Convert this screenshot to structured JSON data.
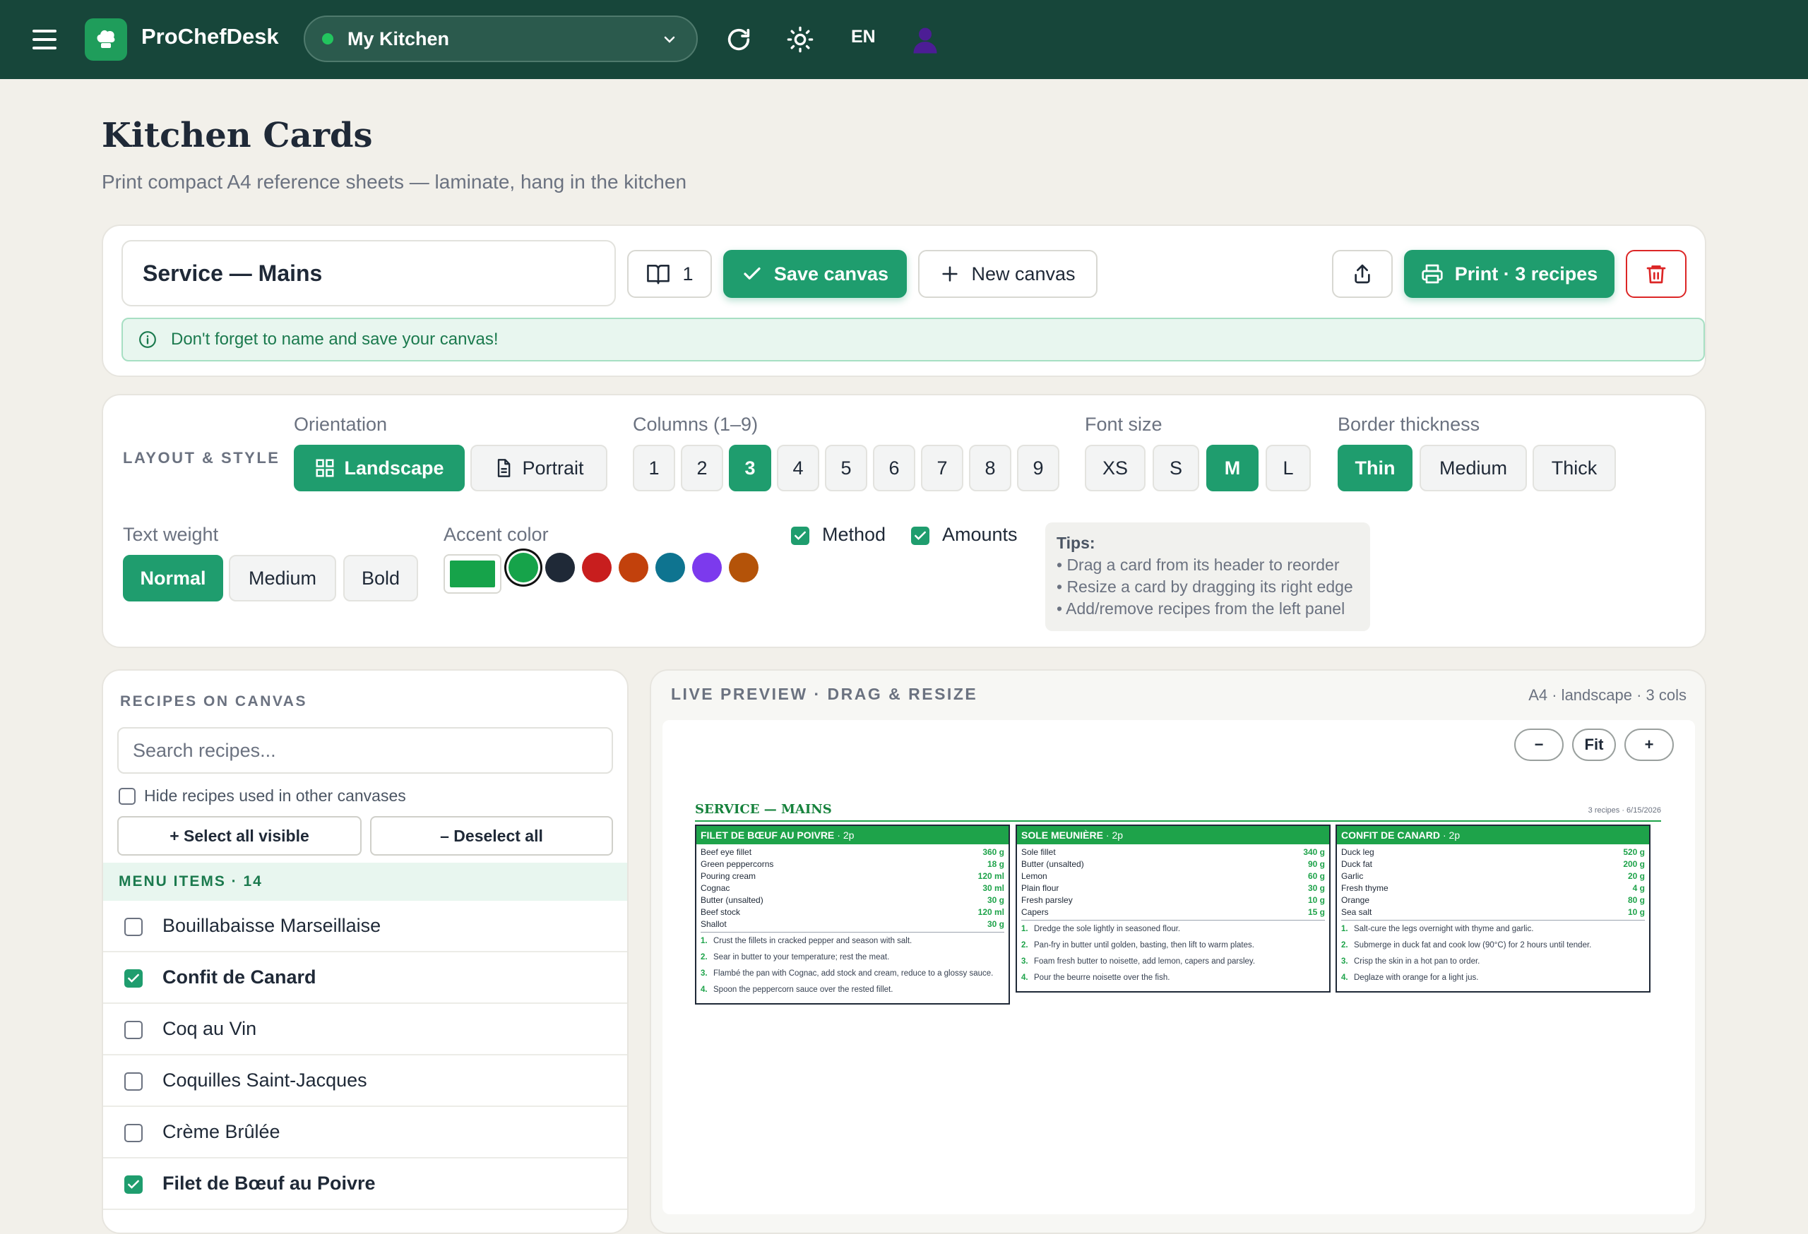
{
  "topbar": {
    "brand": "ProChefDesk",
    "kitchen": "My Kitchen",
    "lang": "EN",
    "icons": [
      "menu-icon",
      "chef-hat-icon",
      "refresh-icon",
      "sun-icon",
      "user-icon"
    ],
    "accent": "#17463a"
  },
  "page": {
    "title": "Kitchen Cards",
    "subtitle": "Print compact A4 reference sheets — laminate, hang in the kitchen"
  },
  "canvas_bar": {
    "name": "Service — Mains",
    "count": "1",
    "save_label": "Save canvas",
    "new_label": "New canvas",
    "print_label": "Print · 3 recipes",
    "notice": "Don't forget to name and save your canvas!"
  },
  "layout": {
    "section_label": "LAYOUT & STYLE",
    "orientation_label": "Orientation",
    "orientation": [
      "Landscape",
      "Portrait"
    ],
    "columns_label": "Columns (1–9)",
    "columns": [
      "1",
      "2",
      "3",
      "4",
      "5",
      "6",
      "7",
      "8",
      "9"
    ],
    "font_size_label": "Font size",
    "font_sizes": [
      "XS",
      "S",
      "M",
      "L"
    ],
    "border_label": "Border thickness",
    "borders": [
      "Thin",
      "Medium",
      "Thick"
    ],
    "weight_label": "Text weight",
    "weights": [
      "Normal",
      "Medium",
      "Bold"
    ],
    "accent_label": "Accent color",
    "accent_current": "#16a34a",
    "swatches": [
      "#16a34a",
      "#1f2937",
      "#c81e1e",
      "#c2410c",
      "#0e7490",
      "#7c3aed",
      "#b45309"
    ],
    "method_label": "Method",
    "amounts_label": "Amounts",
    "tips_title": "Tips:",
    "tips": [
      "• Drag a card from its header to reorder",
      "• Resize a card by dragging its right edge",
      "• Add/remove recipes from the left panel"
    ],
    "selected": {
      "orientation": "Landscape",
      "columns": "3",
      "font_size": "M",
      "border": "Thin",
      "weight": "Normal"
    }
  },
  "recipes_panel": {
    "title": "RECIPES ON CANVAS",
    "search_placeholder": "Search recipes...",
    "hide_label": "Hide recipes used in other canvases",
    "select_all": "+ Select all visible",
    "deselect_all": "– Deselect all",
    "group_label": "MENU ITEMS · 14",
    "items": [
      {
        "name": "Bouillabaisse Marseillaise",
        "checked": false
      },
      {
        "name": "Confit de Canard",
        "checked": true
      },
      {
        "name": "Coq au Vin",
        "checked": false
      },
      {
        "name": "Coquilles Saint-Jacques",
        "checked": false
      },
      {
        "name": "Crème Brûlée",
        "checked": false
      },
      {
        "name": "Filet de Bœuf au Poivre",
        "checked": true
      }
    ]
  },
  "preview": {
    "title": "LIVE PREVIEW · DRAG & RESIZE",
    "meta": "A4 · landscape · 3 cols",
    "zoom_out": "−",
    "fit": "Fit",
    "zoom_in": "+",
    "sheet_title": "SERVICE — MAINS",
    "sheet_meta": "3 recipes · 6/15/2026",
    "cards": [
      {
        "name": "FILET DE BŒUF AU POIVRE",
        "portions": "· 2p",
        "ingredients": [
          [
            "Beef eye fillet",
            "360 g"
          ],
          [
            "Green peppercorns",
            "18 g"
          ],
          [
            "Pouring cream",
            "120 ml"
          ],
          [
            "Cognac",
            "30 ml"
          ],
          [
            "Butter (unsalted)",
            "30 g"
          ],
          [
            "Beef stock",
            "120 ml"
          ],
          [
            "Shallot",
            "30 g"
          ]
        ],
        "steps": [
          "Crust the fillets in cracked pepper and season with salt.",
          "Sear in butter to your temperature; rest the meat.",
          "Flambé the pan with Cognac, add stock and cream, reduce to a glossy sauce.",
          "Spoon the peppercorn sauce over the rested fillet."
        ]
      },
      {
        "name": "SOLE MEUNIÈRE",
        "portions": "· 2p",
        "ingredients": [
          [
            "Sole fillet",
            "340 g"
          ],
          [
            "Butter (unsalted)",
            "90 g"
          ],
          [
            "Lemon",
            "60 g"
          ],
          [
            "Plain flour",
            "30 g"
          ],
          [
            "Fresh parsley",
            "10 g"
          ],
          [
            "Capers",
            "15 g"
          ]
        ],
        "steps": [
          "Dredge the sole lightly in seasoned flour.",
          "Pan-fry in butter until golden, basting, then lift to warm plates.",
          "Foam fresh butter to noisette, add lemon, capers and parsley.",
          "Pour the beurre noisette over the fish."
        ]
      },
      {
        "name": "CONFIT DE CANARD",
        "portions": "· 2p",
        "ingredients": [
          [
            "Duck leg",
            "520 g"
          ],
          [
            "Duck fat",
            "200 g"
          ],
          [
            "Garlic",
            "20 g"
          ],
          [
            "Fresh thyme",
            "4 g"
          ],
          [
            "Orange",
            "80 g"
          ],
          [
            "Sea salt",
            "10 g"
          ]
        ],
        "steps": [
          "Salt-cure the legs overnight with thyme and garlic.",
          "Submerge in duck fat and cook low (90°C) for 2 hours until tender.",
          "Crisp the skin in a hot pan to order.",
          "Deglaze with orange for a light jus."
        ]
      }
    ]
  }
}
